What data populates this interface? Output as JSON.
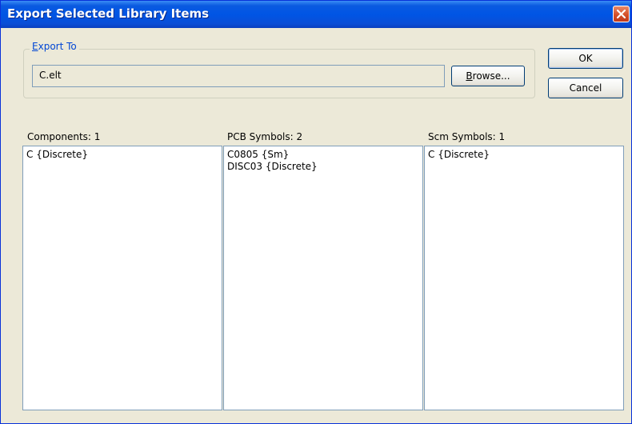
{
  "window": {
    "title": "Export Selected Library Items"
  },
  "export_to": {
    "group_label": "Export To",
    "group_label_accel": "E",
    "group_label_rest": "xport To",
    "path_value": "C.elt",
    "browse_label_accel": "B",
    "browse_label_rest": "rowse..."
  },
  "buttons": {
    "ok": "OK",
    "cancel": "Cancel"
  },
  "columns": [
    {
      "label": "Components:  1",
      "items": [
        "C {Discrete}"
      ]
    },
    {
      "label": "PCB Symbols:  2",
      "items": [
        "C0805 {Sm}",
        "DISC03 {Discrete}"
      ]
    },
    {
      "label": "Scm Symbols:  1",
      "items": [
        "C {Discrete}"
      ]
    }
  ],
  "colors": {
    "titlebar": "#0055e5",
    "dialog_bg": "#ece9d8",
    "close_button": "#d4502a",
    "group_label": "#0046d5"
  },
  "icons": {
    "close": "close-icon"
  }
}
